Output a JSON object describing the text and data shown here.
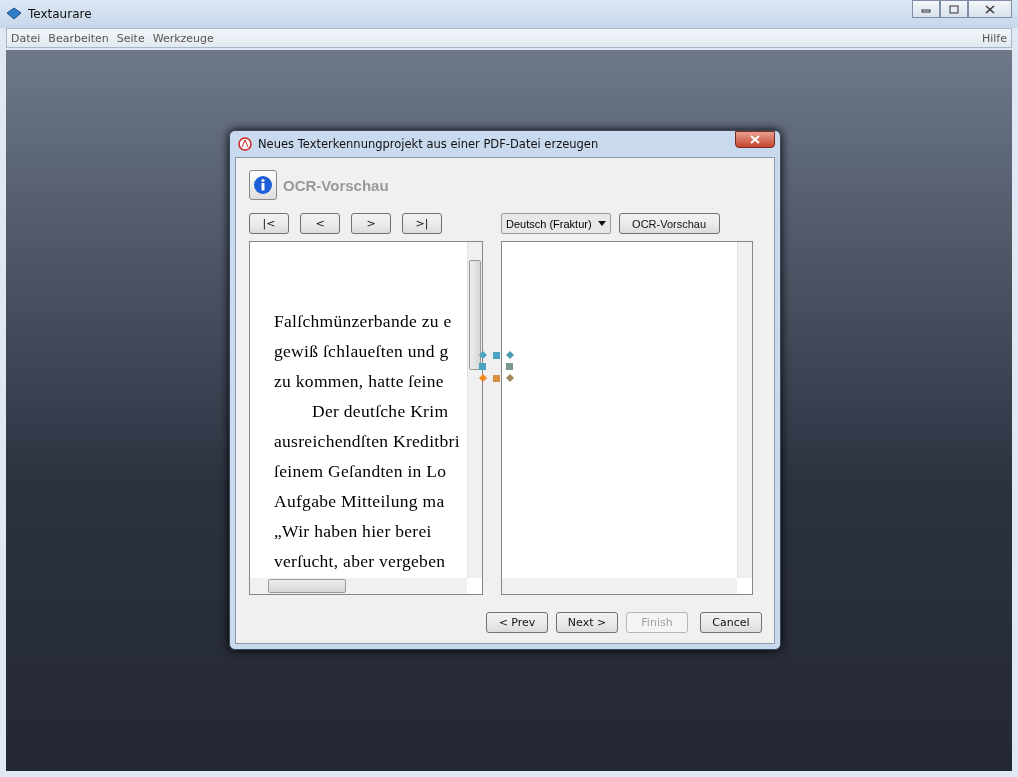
{
  "window": {
    "title": "Textaurare"
  },
  "menu": {
    "items": [
      "Datei",
      "Bearbeiten",
      "Seite",
      "Werkzeuge"
    ],
    "help": "Hilfe"
  },
  "dialog": {
    "title": "Neues Texterkennungprojekt aus einer PDF-Datei erzeugen",
    "header": "OCR-Vorschau",
    "nav_buttons": [
      "|<",
      "<",
      ">",
      ">|"
    ],
    "language": {
      "value": "Deutsch (Fraktur)"
    },
    "ocr_button": "OCR-Vorschau",
    "page_lines": [
      {
        "text": "Falſchmünzerbande zu e",
        "indented": false
      },
      {
        "text": "gewiß ſchlaueſten und g",
        "indented": false
      },
      {
        "text": "zu kommen, hatte ſeine",
        "indented": false
      },
      {
        "text": "Der deutſche Krim",
        "indented": true
      },
      {
        "text": "ausreichendſten Kreditbri",
        "indented": false
      },
      {
        "text": "ſeinem Geſandten in Lo",
        "indented": false
      },
      {
        "text": "Aufgabe Mitteilung ma",
        "indented": false
      },
      {
        "text": "„Wir haben hier berei",
        "indented": false
      },
      {
        "text": "verſucht, aber vergeben",
        "indented": false
      }
    ],
    "footer_buttons": [
      {
        "label": "< Prev",
        "disabled": false
      },
      {
        "label": "Next >",
        "disabled": false
      },
      {
        "label": "Finish",
        "disabled": true
      },
      {
        "label": "Cancel",
        "disabled": false
      }
    ]
  }
}
